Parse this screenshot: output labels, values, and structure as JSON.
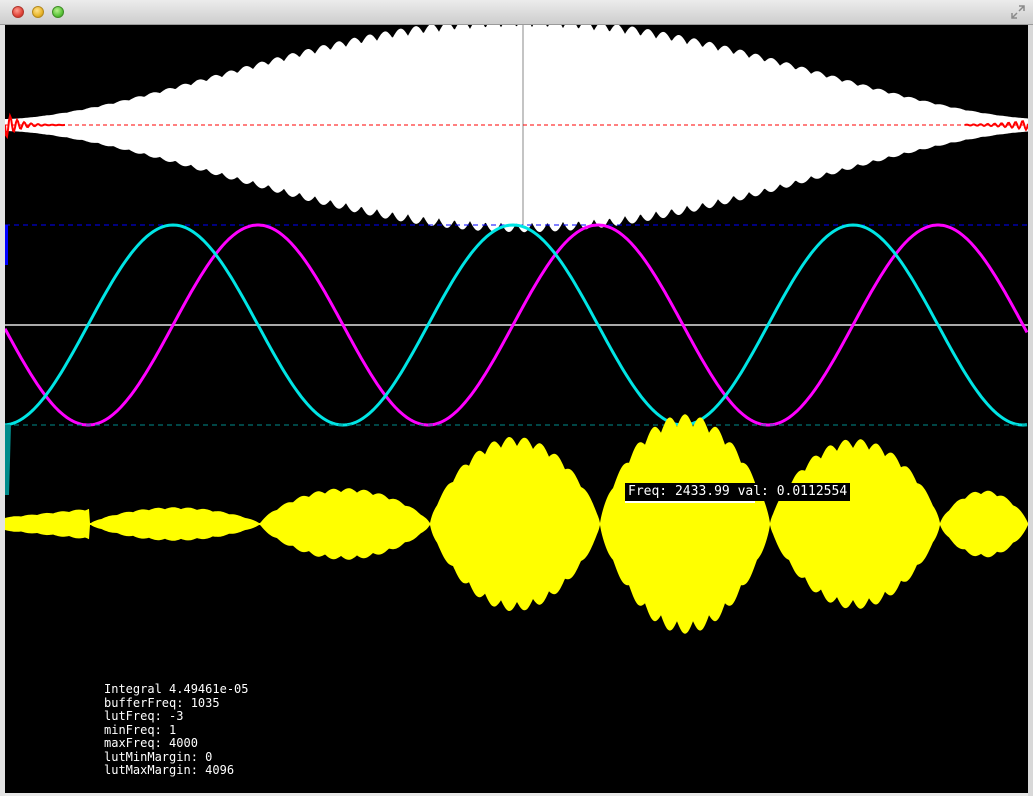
{
  "window": {
    "close_icon": "close-icon",
    "minimize_icon": "minimize-icon",
    "zoom_icon": "zoom-icon",
    "fullscreen_icon": "fullscreen-arrows-icon"
  },
  "tooltip": {
    "text": "Freq: 2433.99 val: 0.0112554"
  },
  "info": {
    "integral": "Integral 4.49461e-05",
    "bufferFreq": "bufferFreq: 1035",
    "lutFreq": "lutFreq: -3",
    "minFreq": "minFreq: 1",
    "maxFreq": "maxFreq: 4000",
    "lutMinMargin": "lutMinMargin: 0",
    "lutMaxMargin": "lutMaxMargin: 4096"
  },
  "colors": {
    "background": "#000000",
    "window_envelope": "#ffffff",
    "residual": "#ff0000",
    "sine": "#ff00ff",
    "cosine": "#00e5e5",
    "axis": "#aaaaaa",
    "spectrum": "#ffff00",
    "marker_blue": "#0000ff",
    "marker_teal": "#008b8b"
  }
}
